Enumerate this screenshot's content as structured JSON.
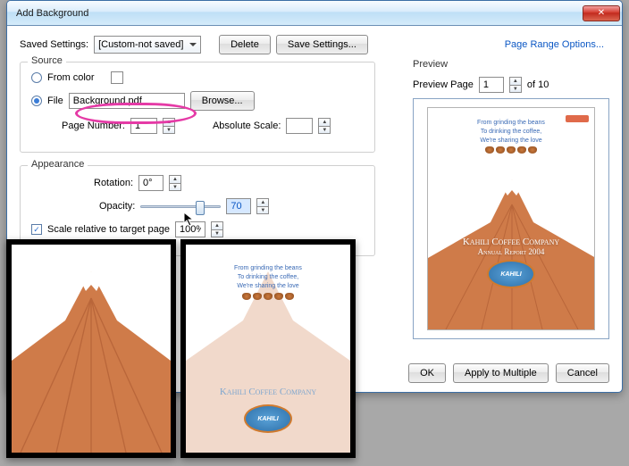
{
  "title": "Add Background",
  "savedSettings": {
    "label": "Saved Settings:",
    "value": "[Custom-not saved]",
    "delete": "Delete",
    "save": "Save Settings..."
  },
  "pageRange": "Page Range Options...",
  "source": {
    "legend": "Source",
    "fromColor": "From color",
    "file": "File",
    "fileValue": "Background.pdf",
    "browse": "Browse...",
    "pageNumber": {
      "label": "Page Number:",
      "value": "1"
    },
    "absoluteScale": {
      "label": "Absolute Scale:",
      "value": ""
    }
  },
  "appearance": {
    "legend": "Appearance",
    "rotation": {
      "label": "Rotation:",
      "value": "0°"
    },
    "opacity": {
      "label": "Opacity:",
      "value": "70"
    },
    "scaleRel": {
      "label": "Scale relative to target page",
      "checked": true,
      "value": "100%"
    }
  },
  "preview": {
    "legend": "Preview",
    "pageLabel": "Preview Page",
    "pageValue": "1",
    "of": "of 10",
    "doc": {
      "line1": "From grinding the beans",
      "line2": "To drinking the coffee,",
      "line3": "We're sharing the love",
      "company": "Kahili Coffee Company",
      "sub": "Annual Report 2004",
      "logo": "KAHILI"
    }
  },
  "buttons": {
    "ok": "OK",
    "apply": "Apply to Multiple",
    "cancel": "Cancel"
  },
  "thumbB": {
    "company": "Kahili Coffee Company",
    "logo": "KAHILI"
  }
}
